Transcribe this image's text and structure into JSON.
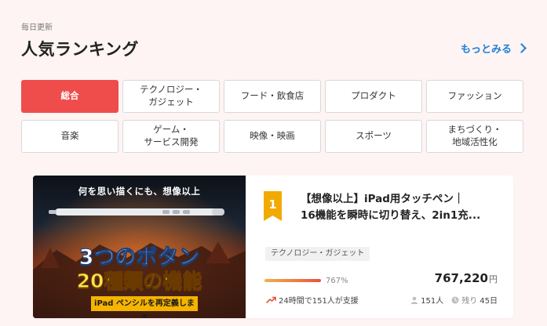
{
  "header": {
    "eyebrow": "毎日更新",
    "title": "人気ランキング",
    "more_label": "もっとみる"
  },
  "categories": [
    {
      "label": "総合",
      "active": true
    },
    {
      "label": "テクノロジー・\nガジェット",
      "active": false
    },
    {
      "label": "フード・飲食店",
      "active": false
    },
    {
      "label": "プロダクト",
      "active": false
    },
    {
      "label": "ファッション",
      "active": false
    },
    {
      "label": "音楽",
      "active": false
    },
    {
      "label": "ゲーム・\nサービス開発",
      "active": false
    },
    {
      "label": "映像・映画",
      "active": false
    },
    {
      "label": "スポーツ",
      "active": false
    },
    {
      "label": "まちづくり・\n地域活性化",
      "active": false
    }
  ],
  "item": {
    "rank": "1",
    "title_line1": "【想像以上】iPad用タッチペン｜",
    "title_line2": "16機能を瞬時に切り替え、2in1充...",
    "tag": "テクノロジー・ガジェット",
    "progress_percent": 767,
    "percent_label": "767%",
    "amount": "767,220",
    "currency": "円",
    "trend_text": "24時間で151人が支援",
    "supporters": "151人",
    "remaining_prefix": "残り",
    "remaining_days": "45日",
    "thumbnail": {
      "top_text": "何を思い描くにも、想像以上",
      "big_line1": "3つのボタン",
      "big_line2": "20種類の機能",
      "badge_text": "iPad ペンシルを再定義します"
    }
  },
  "colors": {
    "accent_red": "#ef4c4c",
    "link_blue": "#1f7fd8",
    "rank_gold": "#f2a900",
    "background": "#fdf4f3"
  }
}
